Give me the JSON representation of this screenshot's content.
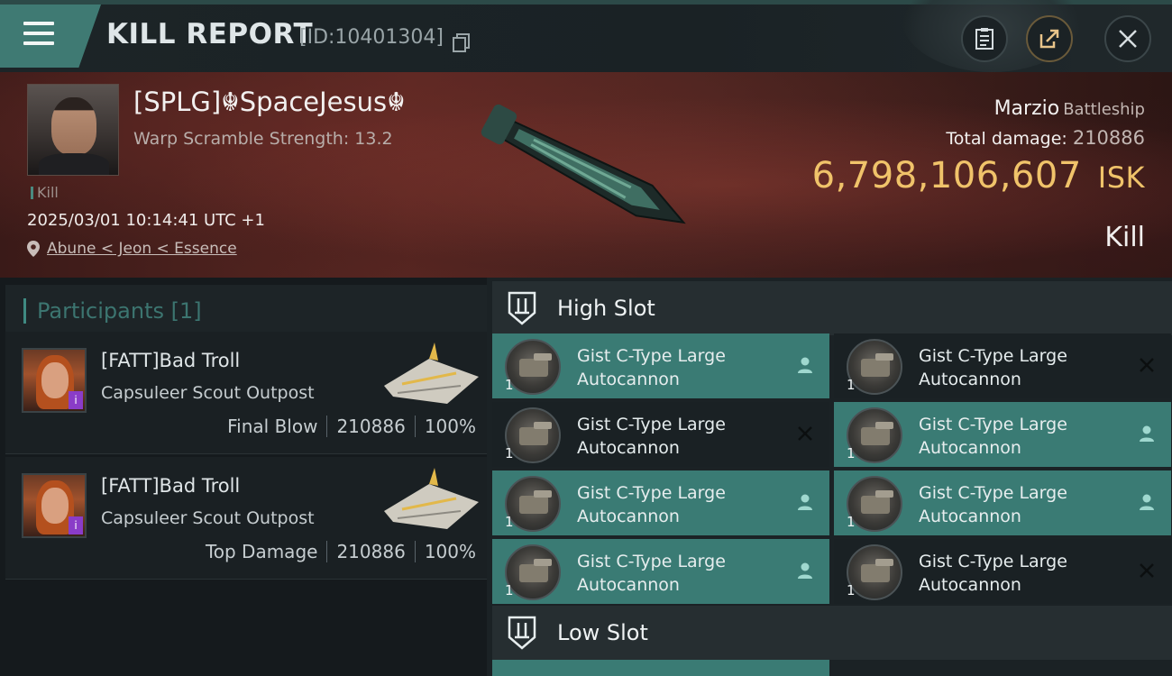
{
  "header": {
    "title": "KILL REPORT",
    "report_id": "[ID:10401304]"
  },
  "victim": {
    "name": "[SPLG]☬SpaceJesus☬",
    "warp_scramble": "Warp Scramble Strength: 13.2",
    "tag": "Kill",
    "datetime": "2025/03/01 10:14:41 UTC +1",
    "location": "Abune < Jeon < Essence",
    "ship_name": "Marzio",
    "ship_class": "Battleship",
    "total_damage_label": "Total damage:",
    "total_damage": "210886",
    "isk_value": "6,798,106,607",
    "isk_unit": "ISK",
    "result": "Kill"
  },
  "participants": {
    "title": "Participants [1]",
    "rows": [
      {
        "name": "[FATT]Bad Troll",
        "corp": "Capsuleer Scout Outpost",
        "role": "Final Blow",
        "damage": "210886",
        "percent": "100%",
        "badge": "i"
      },
      {
        "name": "[FATT]Bad Troll",
        "corp": "Capsuleer Scout Outpost",
        "role": "Top Damage",
        "damage": "210886",
        "percent": "100%",
        "badge": "i"
      }
    ]
  },
  "slots": {
    "high_title": "High Slot",
    "low_title": "Low Slot",
    "modules": [
      {
        "name": "Gist C-Type Large Autocannon",
        "qty": "1",
        "status": "fitted"
      },
      {
        "name": "Gist C-Type Large Autocannon",
        "qty": "1",
        "status": "dropped"
      },
      {
        "name": "Gist C-Type Large Autocannon",
        "qty": "1",
        "status": "dropped"
      },
      {
        "name": "Gist C-Type Large Autocannon",
        "qty": "1",
        "status": "fitted"
      },
      {
        "name": "Gist C-Type Large Autocannon",
        "qty": "1",
        "status": "fitted"
      },
      {
        "name": "Gist C-Type Large Autocannon",
        "qty": "1",
        "status": "fitted"
      },
      {
        "name": "Gist C-Type Large Autocannon",
        "qty": "1",
        "status": "fitted"
      },
      {
        "name": "Gist C-Type Large Autocannon",
        "qty": "1",
        "status": "dropped"
      }
    ]
  },
  "colors": {
    "accent_teal": "#3a7b74",
    "isk_gold": "#f0c36a",
    "banner_red": "#5a2722"
  }
}
